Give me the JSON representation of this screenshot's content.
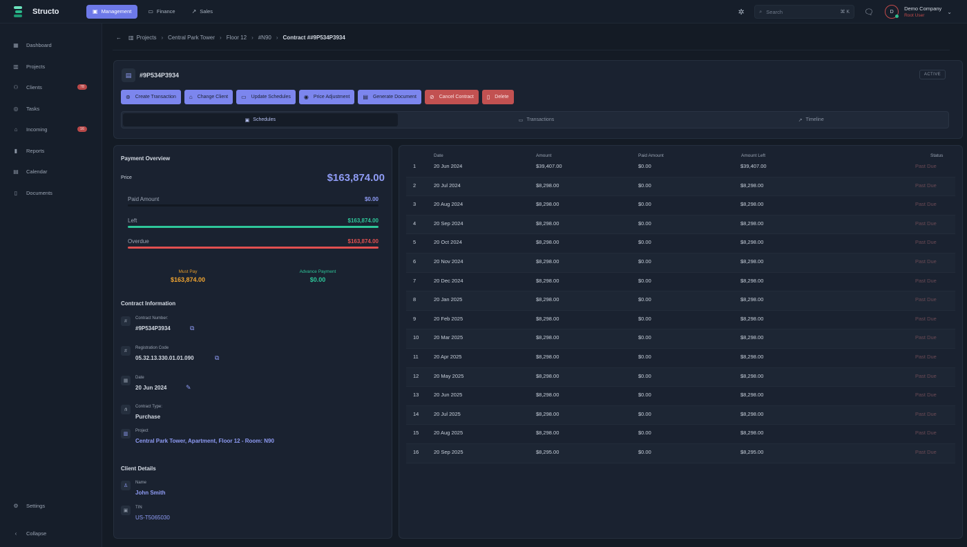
{
  "app": {
    "name": "Structo"
  },
  "modules": [
    {
      "label": "Management",
      "icon": "briefcase-icon"
    },
    {
      "label": "Finance",
      "icon": "wallet-icon"
    },
    {
      "label": "Sales",
      "icon": "trend-icon"
    }
  ],
  "search": {
    "placeholder": "Search",
    "shortcut": "⌘ K"
  },
  "user": {
    "initial": "D",
    "name": "Demo Company",
    "role": "Root User"
  },
  "sidebar": {
    "items": [
      {
        "label": "Dashboard",
        "icon": "dashboard-icon"
      },
      {
        "label": "Projects",
        "icon": "building-icon"
      },
      {
        "label": "Clients",
        "icon": "users-icon",
        "badge": "78"
      },
      {
        "label": "Tasks",
        "icon": "check-circle-icon"
      },
      {
        "label": "Incoming",
        "icon": "bank-icon",
        "badge": "16"
      },
      {
        "label": "Reports",
        "icon": "bar-chart-icon"
      },
      {
        "label": "Calendar",
        "icon": "calendar-icon"
      },
      {
        "label": "Documents",
        "icon": "document-icon"
      }
    ],
    "settings_label": "Settings",
    "collapse_label": "Collapse"
  },
  "breadcrumb": {
    "items": [
      "Projects",
      "Central Park Tower",
      "Floor 12",
      "#N90"
    ],
    "current": "Contract ##9P534P3934"
  },
  "contract": {
    "number": "#9P534P3934",
    "status": "ACTIVE",
    "actions": [
      {
        "label": "Create Transaction",
        "icon": "dollar-circle-icon",
        "style": "primary"
      },
      {
        "label": "Change Client",
        "icon": "user-swap-icon",
        "style": "primary"
      },
      {
        "label": "Update Schedules",
        "icon": "calendar-edit-icon",
        "style": "primary"
      },
      {
        "label": "Price Adjustment",
        "icon": "price-tag-icon",
        "style": "primary"
      },
      {
        "label": "Generate Document",
        "icon": "file-generate-icon",
        "style": "primary"
      },
      {
        "label": "Cancel Contract",
        "icon": "cancel-icon",
        "style": "danger"
      },
      {
        "label": "Delete",
        "icon": "trash-icon",
        "style": "danger"
      }
    ],
    "tabs": [
      {
        "label": "Schedules",
        "icon": "calendar-icon",
        "active": true
      },
      {
        "label": "Transactions",
        "icon": "cash-icon",
        "active": false
      },
      {
        "label": "Timeline",
        "icon": "trend-icon",
        "active": false
      }
    ]
  },
  "payment_overview": {
    "title": "Payment Overview",
    "price_label": "Price",
    "price": "$163,874.00",
    "bars": [
      {
        "label": "Paid Amount",
        "value": "$0.00",
        "fraction": 0,
        "color": "#8f9cf5"
      },
      {
        "label": "Left",
        "value": "$163,874.00",
        "fraction": 1,
        "color": "#2ec79a"
      },
      {
        "label": "Overdue",
        "value": "$163,874.00",
        "fraction": 1,
        "color": "#e25050"
      }
    ],
    "must_pay_label": "Must Pay",
    "must_pay": "$163,874.00",
    "advance_label": "Advance Payment",
    "advance": "$0.00"
  },
  "contract_info": {
    "title": "Contract Information",
    "number_label": "Contract Number:",
    "number": "#9P534P3934",
    "reg_label": "Registration Code",
    "reg_code": "05.32.13.330.01.01.090",
    "date_label": "Date",
    "date": "20 Jun 2024",
    "type_label": "Contract Type:",
    "type": "Purchase",
    "project_label": "Project",
    "project": "Central Park Tower, Apartment, Floor 12 - Room: N90"
  },
  "client": {
    "title": "Client Details",
    "name_label": "Name",
    "name": "John Smith",
    "tin_label": "TIN",
    "tin": "US-T5065030"
  },
  "schedule_table": {
    "headers": [
      "Date",
      "Amount",
      "Paid Amount",
      "Amount Left",
      "Status"
    ],
    "rows": [
      [
        "1",
        "20 Jun 2024",
        "$39,407.00",
        "$0.00",
        "$39,407.00",
        "Past Due"
      ],
      [
        "2",
        "20 Jul 2024",
        "$8,298.00",
        "$0.00",
        "$8,298.00",
        "Past Due"
      ],
      [
        "3",
        "20 Aug 2024",
        "$8,298.00",
        "$0.00",
        "$8,298.00",
        "Past Due"
      ],
      [
        "4",
        "20 Sep 2024",
        "$8,298.00",
        "$0.00",
        "$8,298.00",
        "Past Due"
      ],
      [
        "5",
        "20 Oct 2024",
        "$8,298.00",
        "$0.00",
        "$8,298.00",
        "Past Due"
      ],
      [
        "6",
        "20 Nov 2024",
        "$8,298.00",
        "$0.00",
        "$8,298.00",
        "Past Due"
      ],
      [
        "7",
        "20 Dec 2024",
        "$8,298.00",
        "$0.00",
        "$8,298.00",
        "Past Due"
      ],
      [
        "8",
        "20 Jan 2025",
        "$8,298.00",
        "$0.00",
        "$8,298.00",
        "Past Due"
      ],
      [
        "9",
        "20 Feb 2025",
        "$8,298.00",
        "$0.00",
        "$8,298.00",
        "Past Due"
      ],
      [
        "10",
        "20 Mar 2025",
        "$8,298.00",
        "$0.00",
        "$8,298.00",
        "Past Due"
      ],
      [
        "11",
        "20 Apr 2025",
        "$8,298.00",
        "$0.00",
        "$8,298.00",
        "Past Due"
      ],
      [
        "12",
        "20 May 2025",
        "$8,298.00",
        "$0.00",
        "$8,298.00",
        "Past Due"
      ],
      [
        "13",
        "20 Jun 2025",
        "$8,298.00",
        "$0.00",
        "$8,298.00",
        "Past Due"
      ],
      [
        "14",
        "20 Jul 2025",
        "$8,298.00",
        "$0.00",
        "$8,298.00",
        "Past Due"
      ],
      [
        "15",
        "20 Aug 2025",
        "$8,298.00",
        "$0.00",
        "$8,298.00",
        "Past Due"
      ],
      [
        "16",
        "20 Sep 2025",
        "$8,295.00",
        "$0.00",
        "$8,295.00",
        "Past Due"
      ]
    ]
  }
}
